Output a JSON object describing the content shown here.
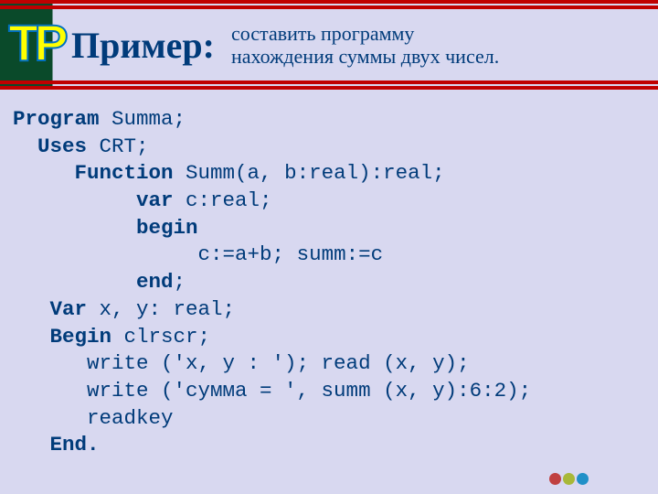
{
  "header": {
    "logo_t": "T",
    "logo_p": "P",
    "title": "Пример:",
    "subtitle_line1": "составить программу",
    "subtitle_line2": "нахождения суммы двух чисел."
  },
  "code": {
    "l1_kw": "Program",
    "l1_rest": " Summa;",
    "l2_kw": "Uses",
    "l2_rest": " CRT;",
    "l3_kw": "Function",
    "l3_rest": " Summ(a, b:real):real;",
    "l4_kw": "var",
    "l4_rest": " c:real;",
    "l5_kw": "begin",
    "l6": "c:=a+b; summ:=c",
    "l7_kw": "end",
    "l7_rest": ";",
    "l8_kw": "Var",
    "l8_rest": " x, y: real;",
    "l9_kw": "Begin",
    "l9_rest": " clrscr;",
    "l10": "write ('x, y : '); read (x, y);",
    "l11": "write ('сумма = ', summ (x, y):6:2);",
    "l12": "readkey",
    "l13_kw": "End."
  }
}
